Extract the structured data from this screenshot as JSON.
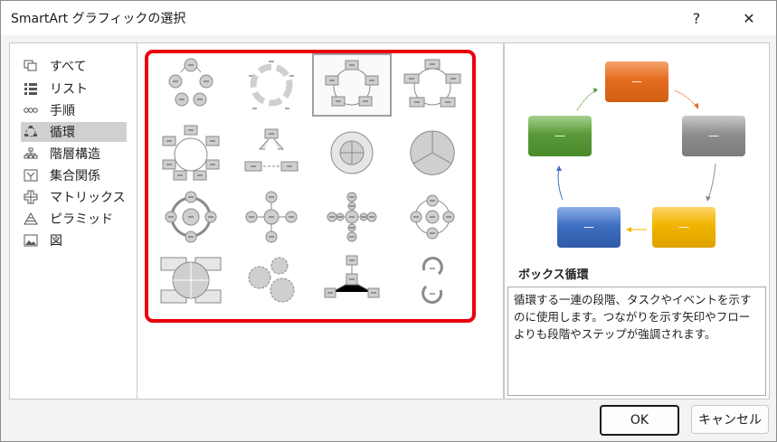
{
  "window": {
    "title": "SmartArt グラフィックの選択",
    "help": "?",
    "close": "✕"
  },
  "categories": [
    {
      "label": "すべて",
      "icon": "all-icon",
      "selected": false
    },
    {
      "label": "リスト",
      "icon": "list-icon",
      "selected": false
    },
    {
      "label": "手順",
      "icon": "process-icon",
      "selected": false
    },
    {
      "label": "循環",
      "icon": "cycle-icon",
      "selected": true
    },
    {
      "label": "階層構造",
      "icon": "hierarchy-icon",
      "selected": false
    },
    {
      "label": "集合関係",
      "icon": "relationship-icon",
      "selected": false
    },
    {
      "label": "マトリックス",
      "icon": "matrix-icon",
      "selected": false
    },
    {
      "label": "ピラミッド",
      "icon": "pyramid-icon",
      "selected": false
    },
    {
      "label": "図",
      "icon": "picture-icon",
      "selected": false
    }
  ],
  "layouts": [
    {
      "name": "basic-cycle"
    },
    {
      "name": "text-cycle"
    },
    {
      "name": "block-cycle",
      "selected": true
    },
    {
      "name": "segmented-cycle"
    },
    {
      "name": "multidirectional-cycle"
    },
    {
      "name": "cycle-matrix"
    },
    {
      "name": "continuous-cycle"
    },
    {
      "name": "segmented-pie"
    },
    {
      "name": "radial-cycle"
    },
    {
      "name": "basic-radial"
    },
    {
      "name": "diverging-radial"
    },
    {
      "name": "radial-venn"
    },
    {
      "name": "cycle-matrix-2"
    },
    {
      "name": "gear"
    },
    {
      "name": "radial-cluster"
    },
    {
      "name": "circle-arrow-process"
    }
  ],
  "preview": {
    "placeholder": "—",
    "colors": {
      "top": "#e46c1f",
      "right": "#8e8e8e",
      "bottom_right": "#f0b400",
      "bottom_left": "#3f6fc1",
      "left": "#5a9a3a"
    }
  },
  "description": {
    "title": "ボックス循環",
    "text": "循環する一連の段階、タスクやイベントを示すのに使用します。つながりを示す矢印やフローよりも段階やステップが強調されます。"
  },
  "buttons": {
    "ok": "OK",
    "cancel": "キャンセル"
  }
}
